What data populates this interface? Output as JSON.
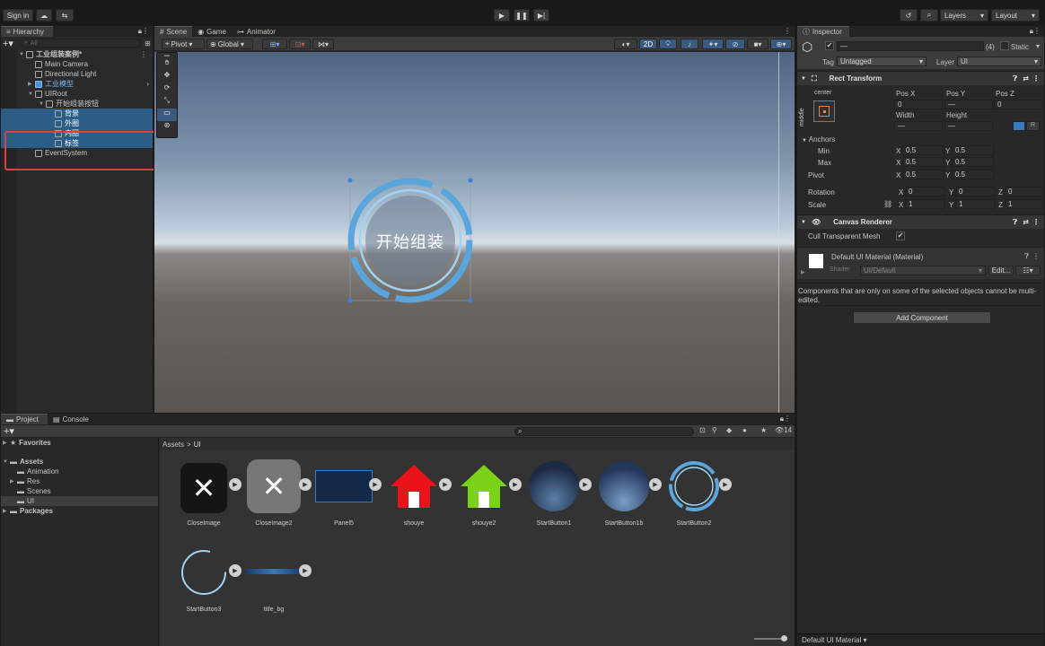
{
  "topbar": {
    "sign_in": "Sign in",
    "layers": "Layers",
    "layout": "Layout"
  },
  "hierarchy": {
    "tab": "Hierarchy",
    "search_placeholder": "All",
    "items": [
      {
        "label": "工业组装案例*",
        "level": 0,
        "bold": true
      },
      {
        "label": "Main Camera",
        "level": 1
      },
      {
        "label": "Directional Light",
        "level": 1
      },
      {
        "label": "工业模型",
        "level": 1,
        "prefab": true
      },
      {
        "label": "UIRoot",
        "level": 1
      },
      {
        "label": "开始组装按钮",
        "level": 2
      },
      {
        "label": "背景",
        "level": 3,
        "selected": true
      },
      {
        "label": "外圈",
        "level": 3,
        "selected": true
      },
      {
        "label": "内圈",
        "level": 3,
        "selected": true
      },
      {
        "label": "标签",
        "level": 3,
        "selected": true
      },
      {
        "label": "EventSystem",
        "level": 1
      }
    ]
  },
  "scene": {
    "tabs": [
      "Scene",
      "Game",
      "Animator"
    ],
    "pivot": "Pivot",
    "global": "Global",
    "mode_2d": "2D",
    "button_text": "开始组装"
  },
  "inspector": {
    "tab": "Inspector",
    "name_value": "—",
    "count": "(4)",
    "static": "Static",
    "tag_label": "Tag",
    "tag_value": "Untagged",
    "layer_label": "Layer",
    "layer_value": "UI",
    "rect_transform": {
      "title": "Rect Transform",
      "anchor_top": "center",
      "anchor_side": "middle",
      "posx": "Pos X",
      "posy": "Pos Y",
      "posz": "Pos Z",
      "posx_val": "0",
      "posy_val": "—",
      "posz_val": "0",
      "width": "Width",
      "height": "Height",
      "width_val": "—",
      "height_val": "—",
      "anchors": "Anchors",
      "min": "Min",
      "max": "Max",
      "pivot": "Pivot",
      "rotation": "Rotation",
      "scale": "Scale",
      "min_x": "0.5",
      "min_y": "0.5",
      "max_x": "0.5",
      "max_y": "0.5",
      "pivot_x": "0.5",
      "pivot_y": "0.5",
      "rot_x": "0",
      "rot_y": "0",
      "rot_z": "0",
      "scale_x": "1",
      "scale_y": "1",
      "scale_z": "1",
      "x": "X",
      "y": "Y",
      "z": "Z",
      "r_btn": "R"
    },
    "canvas_renderer": {
      "title": "Canvas Renderer",
      "cull": "Cull Transparent Mesh"
    },
    "material": {
      "title": "Default UI Material (Material)",
      "shader_label": "Shader",
      "shader_value": "UI/Default",
      "edit": "Edit..."
    },
    "note": "Components that are only on some of the selected objects cannot be multi-edited.",
    "add_component": "Add Component",
    "footer": "Default UI Material"
  },
  "project": {
    "tabs": [
      "Project",
      "Console"
    ],
    "tree": [
      {
        "label": "Favorites",
        "level": 0,
        "star": true
      },
      {
        "label": "Assets",
        "level": 0,
        "bold": true
      },
      {
        "label": "Animation",
        "level": 1
      },
      {
        "label": "Res",
        "level": 1
      },
      {
        "label": "Scenes",
        "level": 1
      },
      {
        "label": "UI",
        "level": 1,
        "selected": true
      },
      {
        "label": "Packages",
        "level": 0,
        "bold": true
      }
    ],
    "breadcrumb_root": "Assets",
    "breadcrumb_sep": ">",
    "breadcrumb_leaf": "UI",
    "count": "14",
    "assets": [
      {
        "name": "CloseImage",
        "kind": "close-dark"
      },
      {
        "name": "CloseImage2",
        "kind": "close-gray"
      },
      {
        "name": "Panel5",
        "kind": "panel"
      },
      {
        "name": "shouye",
        "kind": "house-red"
      },
      {
        "name": "shouye2",
        "kind": "house-green"
      },
      {
        "name": "StartButton1",
        "kind": "sphere"
      },
      {
        "name": "StartButton1b",
        "kind": "sphere2"
      },
      {
        "name": "StartButton2",
        "kind": "ring"
      },
      {
        "name": "StartButton3",
        "kind": "ring-thin"
      },
      {
        "name": "title_bg",
        "kind": "bar"
      }
    ]
  },
  "colors": {
    "selection": "#2c5d87",
    "highlight": "#e0403c",
    "accent": "#3a79bb"
  }
}
